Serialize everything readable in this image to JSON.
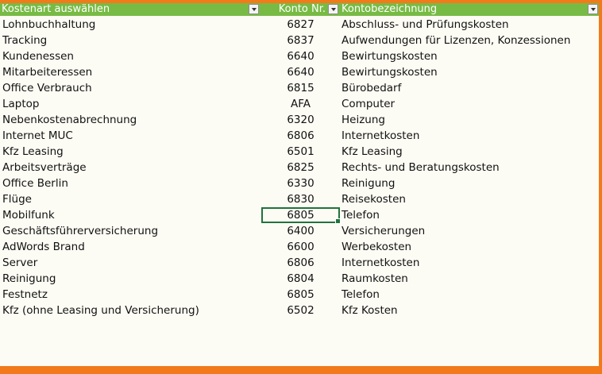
{
  "header": {
    "col1": "Kostenart auswählen",
    "col2": "Konto Nr.",
    "col3": "Kontobezeichnung"
  },
  "rows": [
    {
      "name": "Lohnbuchhaltung",
      "konto": "6827",
      "bezeichnung": "Abschluss- und Prüfungskosten"
    },
    {
      "name": "Tracking",
      "konto": "6837",
      "bezeichnung": "Aufwendungen für Lizenzen, Konzessionen"
    },
    {
      "name": "Kundenessen",
      "konto": "6640",
      "bezeichnung": "Bewirtungskosten"
    },
    {
      "name": "Mitarbeiteressen",
      "konto": "6640",
      "bezeichnung": "Bewirtungskosten"
    },
    {
      "name": "Office Verbrauch",
      "konto": "6815",
      "bezeichnung": "Bürobedarf"
    },
    {
      "name": "Laptop",
      "konto": "AFA",
      "bezeichnung": "Computer"
    },
    {
      "name": "Nebenkostenabrechnung",
      "konto": "6320",
      "bezeichnung": "Heizung"
    },
    {
      "name": "Internet MUC",
      "konto": "6806",
      "bezeichnung": "Internetkosten"
    },
    {
      "name": "Kfz Leasing",
      "konto": "6501",
      "bezeichnung": "Kfz Leasing"
    },
    {
      "name": "Arbeitsverträge",
      "konto": "6825",
      "bezeichnung": "Rechts- und Beratungskosten"
    },
    {
      "name": "Office Berlin",
      "konto": "6330",
      "bezeichnung": "Reinigung"
    },
    {
      "name": "Flüge",
      "konto": "6830",
      "bezeichnung": "Reisekosten"
    },
    {
      "name": "Mobilfunk",
      "konto": "6805",
      "bezeichnung": "Telefon"
    },
    {
      "name": "Geschäftsführerversicherung",
      "konto": "6400",
      "bezeichnung": "Versicherungen"
    },
    {
      "name": "AdWords Brand",
      "konto": "6600",
      "bezeichnung": "Werbekosten"
    },
    {
      "name": "Server",
      "konto": "6806",
      "bezeichnung": "Internetkosten"
    },
    {
      "name": "Reinigung",
      "konto": "6804",
      "bezeichnung": "Raumkosten"
    },
    {
      "name": "Festnetz",
      "konto": "6805",
      "bezeichnung": "Telefon"
    },
    {
      "name": "Kfz (ohne Leasing und Versicherung)",
      "konto": "6502",
      "bezeichnung": "Kfz Kosten"
    }
  ],
  "selected_row_index": 12,
  "colors": {
    "header_bg": "#77bb45",
    "frame": "#f27a1a",
    "sheet_bg": "#fdfcf4",
    "selection": "#21733d"
  },
  "icons": {
    "filter": "dropdown-arrow-icon"
  }
}
